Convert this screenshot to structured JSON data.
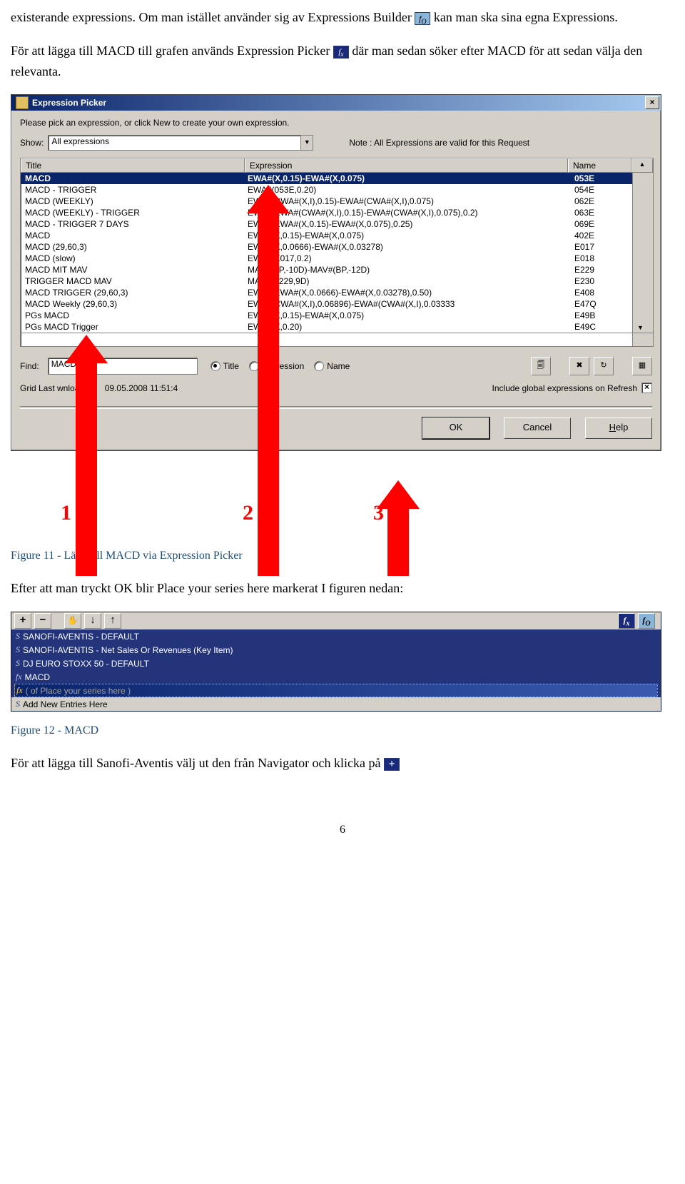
{
  "para1a": "existerande expressions. Om man istället använder sig av Expressions Builder ",
  "para1b": " kan man ska sina egna Expressions.",
  "para2a": "För att lägga till MACD till grafen används Expression Picker ",
  "para2b": " där man sedan söker efter MACD för att sedan välja den relevanta.",
  "picker": {
    "title": "Expression Picker",
    "close": "×",
    "prompt": "Please pick an expression, or click New to create your own expression.",
    "show_lbl": "Show:",
    "show_val": "All expressions",
    "note": "Note : All Expressions are valid for this Request",
    "hdr_title": "Title",
    "hdr_expr": "Expression",
    "hdr_name": "Name",
    "rows": [
      {
        "t": "MACD",
        "e": "EWA#(X,0.15)-EWA#(X,0.075)",
        "n": "053E"
      },
      {
        "t": "MACD - TRIGGER",
        "e": "EWA#(053E,0.20)",
        "n": "054E"
      },
      {
        "t": "MACD (WEEKLY)",
        "e": "EWA#(CWA#(X,I),0.15)-EWA#(CWA#(X,I),0.075)",
        "n": "062E"
      },
      {
        "t": "MACD (WEEKLY) - TRIGGER",
        "e": "EWA#(EWA#(CWA#(X,I),0.15)-EWA#(CWA#(X,I),0.075),0.2)",
        "n": "063E"
      },
      {
        "t": "MACD - TRIGGER 7 DAYS",
        "e": "EWA#(EWA#(X,0.15)-EWA#(X,0.075),0.25)",
        "n": "069E"
      },
      {
        "t": "MACD",
        "e": "EWA#(X,0.15)-EWA#(X,0.075)",
        "n": "402E"
      },
      {
        "t": "MACD (29,60,3)",
        "e": "EWA#(X,0.0666)-EWA#(X,0.03278)",
        "n": "E017"
      },
      {
        "t": "MACD (slow)",
        "e": "EWA#(E017,0.2)",
        "n": "E018"
      },
      {
        "t": "MACD MIT MAV",
        "e": "MAV#(BP,-10D)-MAV#(BP,-12D)",
        "n": "E229"
      },
      {
        "t": "TRIGGER MACD MAV",
        "e": "MAV#(E229,9D)",
        "n": "E230"
      },
      {
        "t": "MACD TRIGGER (29,60,3)",
        "e": "EWA#(EWA#(X,0.0666)-EWA#(X,0.03278),0.50)",
        "n": "E408"
      },
      {
        "t": "MACD Weekly (29,60,3)",
        "e": "EWA#(CWA#(X,I),0.06896)-EWA#(CWA#(X,I),0.03333",
        "n": "E47Q"
      },
      {
        "t": "PGs MACD",
        "e": "EWA#(X,0.15)-EWA#(X,0.075)",
        "n": "E49B"
      },
      {
        "t": "PGs MACD Trigger",
        "e": "EWA#(X,0.20)",
        "n": "E49C"
      }
    ],
    "find_lbl": "Find:",
    "find_val": "MACD",
    "r_title": "Title",
    "r_expr": "Expression",
    "r_name": "Name",
    "grid_lbl": "Grid Last   wnloaded:",
    "grid_ts": "09.05.2008 11:51:4",
    "incl_lbl": "Include global expressions on Refresh",
    "chk": "×",
    "ok": "OK",
    "cancel": "Cancel",
    "help": "Help"
  },
  "callouts": {
    "n1": "1",
    "n2": "2",
    "n3": "3"
  },
  "caption1": "Figure 11 - Lägg till MACD via Expression Picker",
  "para3": "Efter att man tryckt OK blir Place your series here markerat I figuren nedan:",
  "series": {
    "items": [
      {
        "pfx": "S",
        "txt": "SANOFI-AVENTIS - DEFAULT"
      },
      {
        "pfx": "S",
        "txt": "SANOFI-AVENTIS - Net Sales Or Revenues (Key Item)"
      },
      {
        "pfx": "S",
        "txt": "DJ EURO STOXX 50 - DEFAULT"
      },
      {
        "pfx": "fx",
        "txt": "MACD"
      }
    ],
    "sel_pfx": "fx",
    "sel_txt": "( of Place your series here )",
    "add_pfx": "S",
    "add_txt": "Add New Entries Here"
  },
  "caption2": "Figure 12 - MACD",
  "para4": "För att lägga till Sanofi-Aventis välj ut den från Navigator och klicka på ",
  "pagenum": "6"
}
